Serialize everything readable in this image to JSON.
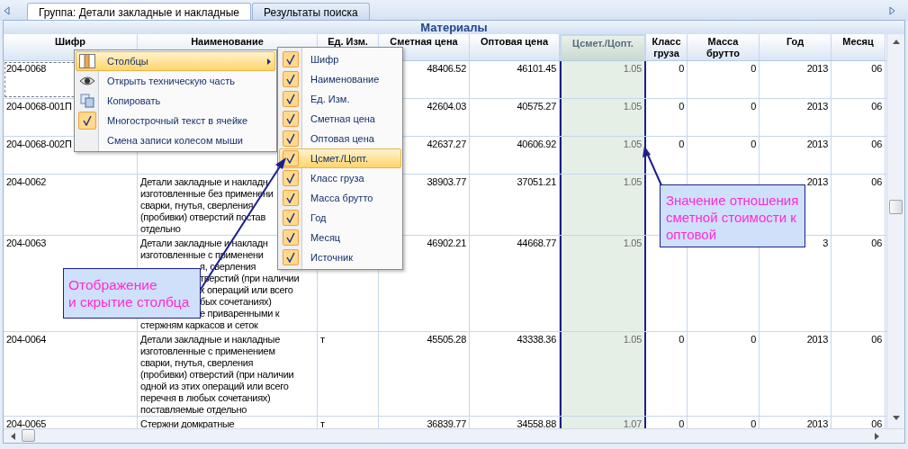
{
  "tabs": [
    {
      "label": "Группа: Детали закладные и накладные",
      "selected": true
    },
    {
      "label": "Результаты поиска",
      "selected": false
    }
  ],
  "table": {
    "title": "Материалы",
    "columns": [
      {
        "label": "Шифр",
        "selected": false
      },
      {
        "label": "Наименование",
        "selected": false
      },
      {
        "label": "Ед. Изм.",
        "selected": false
      },
      {
        "label": "Сметная цена",
        "selected": false
      },
      {
        "label": "Оптовая цена",
        "selected": false
      },
      {
        "label": "Цсмет./Цопт.",
        "selected": true
      },
      {
        "label": "Класс\nгруза",
        "selected": false
      },
      {
        "label": "Масса\nбрутто",
        "selected": false
      },
      {
        "label": "Год",
        "selected": false
      },
      {
        "label": "Месяц",
        "selected": false
      }
    ],
    "rows": [
      {
        "focused": true,
        "code": "204-0068",
        "est": "48406.52",
        "whole": "46101.45",
        "ratio": "1.05",
        "klass": "0",
        "mass": "0",
        "year": "2013",
        "month": "06"
      },
      {
        "focused": false,
        "code": "204-0068-001П",
        "est": "42604.03",
        "whole": "40575.27",
        "ratio": "1.05",
        "klass": "0",
        "mass": "0",
        "year": "2013",
        "month": "06"
      },
      {
        "focused": false,
        "code": "204-0068-002П",
        "est": "42637.27",
        "whole": "40606.92",
        "ratio": "1.05",
        "klass": "0",
        "mass": "0",
        "year": "2013",
        "month": "06"
      },
      {
        "focused": false,
        "code": "204-0062",
        "name_lines": [
          {
            "text": "Детали закладные и накладн",
            "kind": "line"
          },
          {
            "text": "изготовленные без применени",
            "kind": "line"
          },
          {
            "text": "сварки, гнутья, сверления",
            "kind": "line"
          },
          {
            "text": "(пробивки) отверстий постав",
            "kind": "line"
          },
          {
            "text": "отдельно",
            "kind": "line"
          }
        ],
        "est": "38903.77",
        "whole": "37051.21",
        "ratio": "1.05",
        "year": "2013",
        "month": "06"
      },
      {
        "focused": false,
        "code": "204-0063",
        "name_lines": [
          {
            "text": "Детали закладные и накладн",
            "kind": "line"
          },
          {
            "text": "изготовленные с применени",
            "kind": "line"
          },
          {
            "text": "я, сверления",
            "kind": "tail"
          },
          {
            "text": "тверстий (при наличии",
            "kind": "tail"
          },
          {
            "text": "х операций или всего",
            "kind": "tail"
          },
          {
            "text": "бых сочетаниях)",
            "kind": "tail"
          },
          {
            "text": "е приваренными к",
            "kind": "tail"
          },
          {
            "text": "стержням каркасов и сеток",
            "kind": "line"
          }
        ],
        "est": "46902.21",
        "whole": "44668.77",
        "ratio": "1.05",
        "year": "3",
        "month": "06"
      },
      {
        "focused": false,
        "code": "204-0064",
        "name_lines": [
          {
            "text": "Детали закладные и накладные",
            "kind": "line"
          },
          {
            "text": "изготовленные с применением",
            "kind": "line"
          },
          {
            "text": "сварки, гнутья, сверления",
            "kind": "line"
          },
          {
            "text": "(пробивки) отверстий (при наличии",
            "kind": "line"
          },
          {
            "text": "одной из этих операций или всего",
            "kind": "line"
          },
          {
            "text": "перечня в любых сочетаниях)",
            "kind": "line"
          },
          {
            "text": "поставляемые отдельно",
            "kind": "line"
          }
        ],
        "unit": "т",
        "est": "45505.28",
        "whole": "43338.36",
        "ratio": "1.05",
        "klass": "0",
        "mass": "0",
        "year": "2013",
        "month": "06"
      },
      {
        "focused": false,
        "code": "204-0065",
        "name_lines": [
          {
            "text": "Стержни домкратные",
            "kind": "line"
          }
        ],
        "unit": "т",
        "est": "36839.77",
        "whole": "34558.88",
        "ratio": "1.07",
        "klass": "0",
        "mass": "0",
        "year": "2013",
        "month": "06"
      }
    ]
  },
  "context_menu": {
    "items": [
      {
        "label": "Столбцы",
        "kind": "columns",
        "selected": true,
        "checked": false,
        "submenu": true
      },
      {
        "label": "Открыть техническую часть",
        "kind": "eye",
        "selected": false,
        "checked": false,
        "submenu": false
      },
      {
        "label": "Копировать",
        "kind": "copy",
        "selected": false,
        "checked": false,
        "submenu": false
      },
      {
        "label": "Многострочный текст в ячейке",
        "kind": "check",
        "selected": false,
        "checked": true,
        "submenu": false
      },
      {
        "label": "Смена записи колесом мыши",
        "kind": "plain",
        "selected": false,
        "checked": false,
        "submenu": false
      }
    ]
  },
  "columns_submenu": {
    "items": [
      {
        "label": "Шифр",
        "checked": true,
        "selected": false
      },
      {
        "label": "Наименование",
        "checked": true,
        "selected": false
      },
      {
        "label": "Ед. Изм.",
        "checked": true,
        "selected": false
      },
      {
        "label": "Сметная цена",
        "checked": true,
        "selected": false
      },
      {
        "label": "Оптовая цена",
        "checked": true,
        "selected": false
      },
      {
        "label": "Цсмет./Цопт.",
        "checked": true,
        "selected": true
      },
      {
        "label": "Класс груза",
        "checked": true,
        "selected": false
      },
      {
        "label": "Масса брутто",
        "checked": true,
        "selected": false
      },
      {
        "label": "Год",
        "checked": true,
        "selected": false
      },
      {
        "label": "Месяц",
        "checked": true,
        "selected": false
      },
      {
        "label": "Источник",
        "checked": true,
        "selected": false
      }
    ]
  },
  "callouts": [
    {
      "text": "Отображение\nи скрытие столбца"
    },
    {
      "text": "Значение отношения\nсметной стоимости к\nоптовой"
    }
  ]
}
